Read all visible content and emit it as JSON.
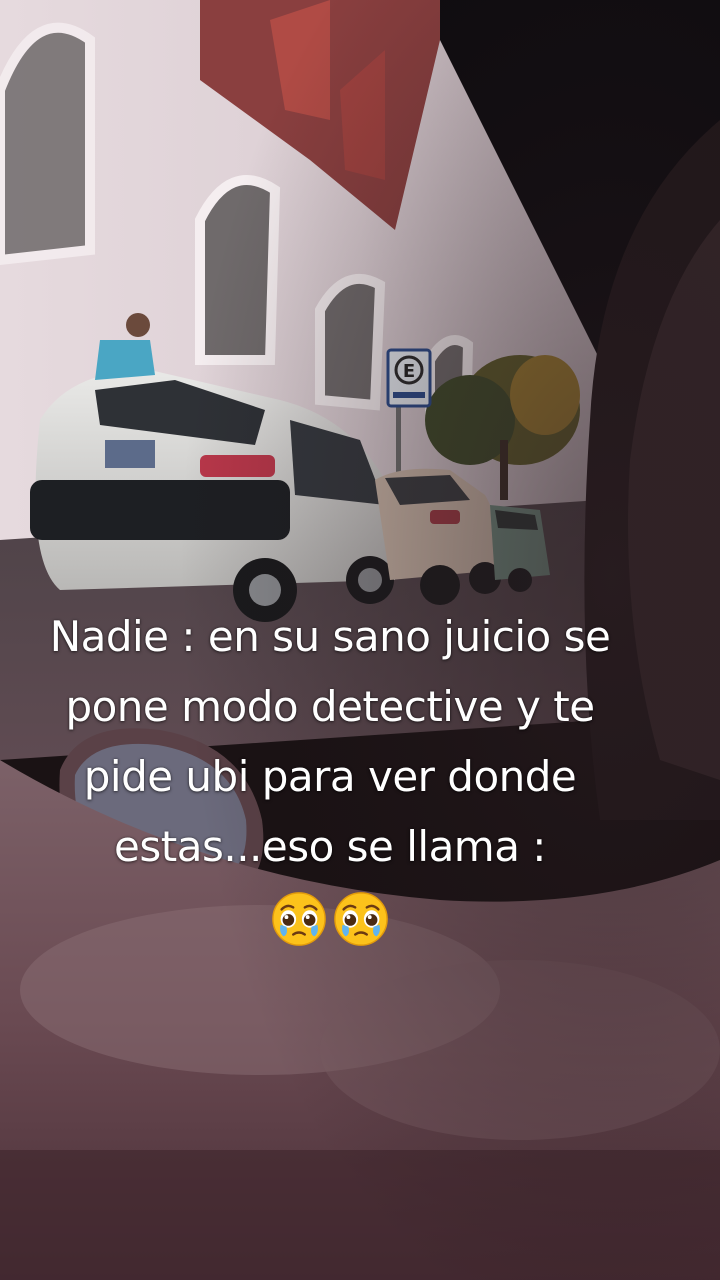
{
  "caption": {
    "lines": [
      "Nadie : en su sano juicio se",
      "pone modo detective y te",
      "pide ubi para ver donde",
      "estas...eso se llama :"
    ],
    "emojis": [
      "pleading-face-icon",
      "pleading-face-icon"
    ]
  },
  "sign": {
    "letter": "E"
  },
  "colors": {
    "sky": "#0f0c10",
    "wall": "#e9dde0",
    "brick": "#8a3f3f",
    "tree": "#7a6a2a",
    "car": "#d8d8d6",
    "dashboard": "#6e4f56",
    "text": "#ffffff"
  }
}
